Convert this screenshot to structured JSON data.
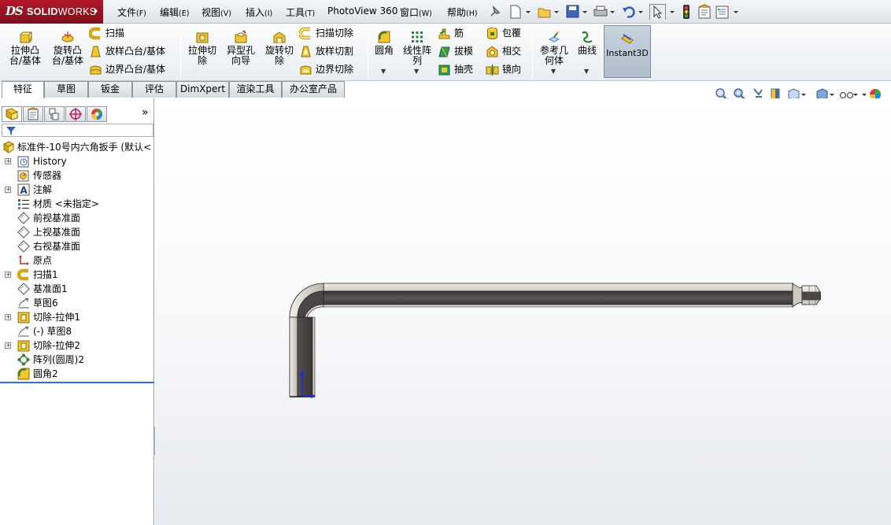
{
  "app": {
    "logo_ds": "DS",
    "logo_text_a": "SOLID",
    "logo_text_b": "WORKS"
  },
  "menu": [
    {
      "name": "文件",
      "key": "(F)"
    },
    {
      "name": "编辑",
      "key": "(E)"
    },
    {
      "name": "视图",
      "key": "(V)"
    },
    {
      "name": "插入",
      "key": "(I)"
    },
    {
      "name": "工具",
      "key": "(T)"
    },
    {
      "name": "PhotoView 360",
      "key": ""
    },
    {
      "name": "窗口",
      "key": "(W)"
    },
    {
      "name": "帮助",
      "key": "(H)"
    }
  ],
  "ribbon": {
    "extrude_boss": "拉伸凸\n台/基体",
    "revolve_boss": "旋转凸\n台/基体",
    "sweep": "扫描",
    "loft_boss": "放样凸台/基体",
    "boundary_boss": "边界凸台/基体",
    "extrude_cut": "拉伸切\n除",
    "hole_wizard": "异型孔\n向导",
    "revolve_cut": "旋转切\n除",
    "swept_cut": "扫描切除",
    "lofted_cut": "放样切割",
    "boundary_cut": "边界切除",
    "fillet": "圆角",
    "linear_pattern": "线性阵\n列",
    "rib": "筋",
    "draft": "拔模",
    "shell": "抽壳",
    "wrap": "包覆",
    "intersect": "相交",
    "mirror": "镜向",
    "ref_geometry": "参考几\n何体",
    "curves": "曲线",
    "instant3d": "Instant3D"
  },
  "tabs": [
    "特征",
    "草图",
    "钣金",
    "评估",
    "DimXpert",
    "渲染工具",
    "办公室产品"
  ],
  "active_tab": 0,
  "feature_tree": {
    "root": "标准件-10号内六角扳手 (默认<",
    "items": [
      {
        "label": "History",
        "icon": "history-icon",
        "expandable": true
      },
      {
        "label": "传感器",
        "icon": "sensor-icon",
        "expandable": false
      },
      {
        "label": "注解",
        "icon": "annotation-icon",
        "expandable": true
      },
      {
        "label": "材质 <未指定>",
        "icon": "material-icon",
        "expandable": false
      },
      {
        "label": "前视基准面",
        "icon": "plane-icon",
        "expandable": false
      },
      {
        "label": "上视基准面",
        "icon": "plane-icon",
        "expandable": false
      },
      {
        "label": "右视基准面",
        "icon": "plane-icon",
        "expandable": false
      },
      {
        "label": "原点",
        "icon": "origin-icon",
        "expandable": false
      },
      {
        "label": "扫描1",
        "icon": "sweep-icon",
        "expandable": true
      },
      {
        "label": "基准面1",
        "icon": "plane-icon",
        "expandable": false
      },
      {
        "label": "草图6",
        "icon": "sketch-icon",
        "expandable": false
      },
      {
        "label": "切除-拉伸1",
        "icon": "cut-extrude-icon",
        "expandable": true
      },
      {
        "label": "(-) 草图8",
        "icon": "sketch-icon",
        "expandable": false
      },
      {
        "label": "切除-拉伸2",
        "icon": "cut-extrude-icon",
        "expandable": true
      },
      {
        "label": "阵列(圆周)2",
        "icon": "circular-pattern-icon",
        "expandable": false
      },
      {
        "label": "圆角2",
        "icon": "fillet-icon",
        "expandable": false
      }
    ]
  },
  "colors": {
    "logo_red": "#a3172a",
    "rollback_bar": "#2f6fd0",
    "part_light": "#e7e2dc",
    "part_dark": "#4a4446"
  }
}
